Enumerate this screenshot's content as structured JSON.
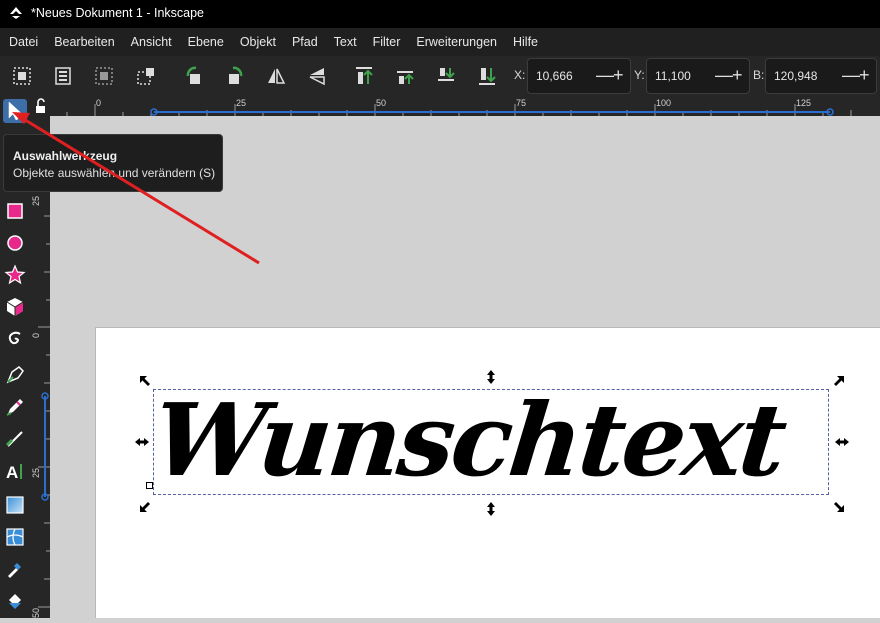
{
  "window": {
    "title": "*Neues Dokument 1 - Inkscape"
  },
  "menu": [
    "Datei",
    "Bearbeiten",
    "Ansicht",
    "Ebene",
    "Objekt",
    "Pfad",
    "Text",
    "Filter",
    "Erweiterungen",
    "Hilfe"
  ],
  "coords": {
    "x_label": "X:",
    "x_value": "10,666",
    "y_label": "Y:",
    "y_value": "11,100",
    "w_label": "B:",
    "w_value": "120,948",
    "minus": "—",
    "plus": "+"
  },
  "ruler": {
    "h_labels": [
      "0",
      "25",
      "50",
      "75",
      "100",
      "125"
    ],
    "v_labels": [
      "25",
      "0",
      "25",
      "50"
    ]
  },
  "canvas": {
    "text": "Wunschtext"
  },
  "tooltip": {
    "title": "Auswahlwerkzeug",
    "description": "Objekte auswählen und verändern (S)"
  },
  "colors": {
    "accent": "#3d6ea8",
    "annotation_arrow": "#e02020",
    "rect_tool": "#e8288a"
  },
  "icons": [
    "select-tool-icon",
    "rect-tool-icon",
    "circle-tool-icon",
    "star-tool-icon",
    "3dbox-tool-icon",
    "spiral-tool-icon",
    "pen-tool-icon",
    "pencil-tool-icon",
    "calligraphy-tool-icon",
    "text-tool-icon",
    "gradient-tool-icon",
    "mesh-tool-icon",
    "dropper-tool-icon",
    "paint-bucket-tool-icon"
  ]
}
